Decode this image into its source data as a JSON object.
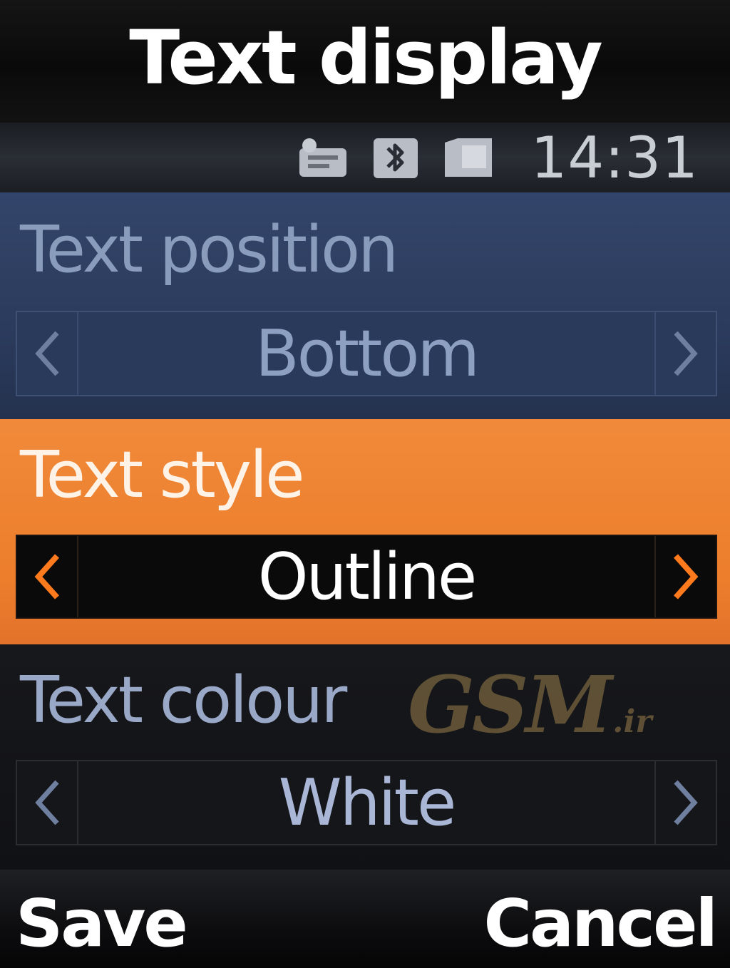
{
  "header": {
    "title": "Text display"
  },
  "status_bar": {
    "icons": [
      "message-icon",
      "bluetooth-icon",
      "memory-card-icon"
    ],
    "time": "14:31"
  },
  "settings": [
    {
      "label": "Text position",
      "value": "Bottom",
      "state": "normal"
    },
    {
      "label": "Text style",
      "value": "Outline",
      "state": "selected"
    },
    {
      "label": "Text colour",
      "value": "White",
      "state": "normal"
    }
  ],
  "watermark": {
    "main": "GSM",
    "sub": ".ir"
  },
  "softkeys": {
    "left": "Save",
    "right": "Cancel"
  },
  "colors": {
    "highlight": "#ec7e2c",
    "arrow_active": "#ff7a1c",
    "arrow_inactive": "#6f7f9f"
  }
}
